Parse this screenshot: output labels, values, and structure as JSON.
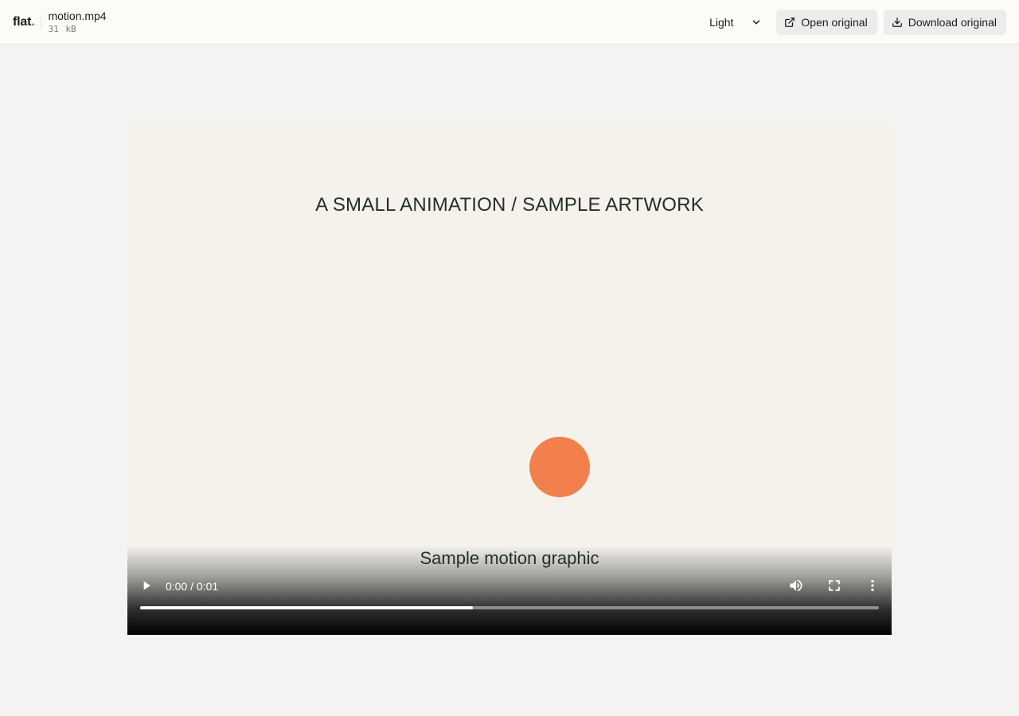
{
  "header": {
    "brand": "flat",
    "brand_dot": ".",
    "brand_dot_color": "#e2483d",
    "file_name": "motion.mp4",
    "file_size": "31 kB",
    "theme": {
      "selected": "Light",
      "icon": "chevron-down-icon"
    },
    "open_original": {
      "label": "Open original",
      "icon": "external-link-icon"
    },
    "download_original": {
      "label": "Download original",
      "icon": "download-icon"
    }
  },
  "video": {
    "artwork_heading": "A SMALL ANIMATION / SAMPLE ARTWORK",
    "artwork_caption": "Sample motion graphic",
    "circle_color": "#f2804c",
    "background_color": "#f5f2ec",
    "controls": {
      "play_icon": "play-icon",
      "time_display": "0:00 / 0:01",
      "volume_icon": "volume-icon",
      "fullscreen_icon": "fullscreen-icon",
      "more_icon": "more-vertical-icon",
      "progress_fraction": 0.45
    }
  }
}
